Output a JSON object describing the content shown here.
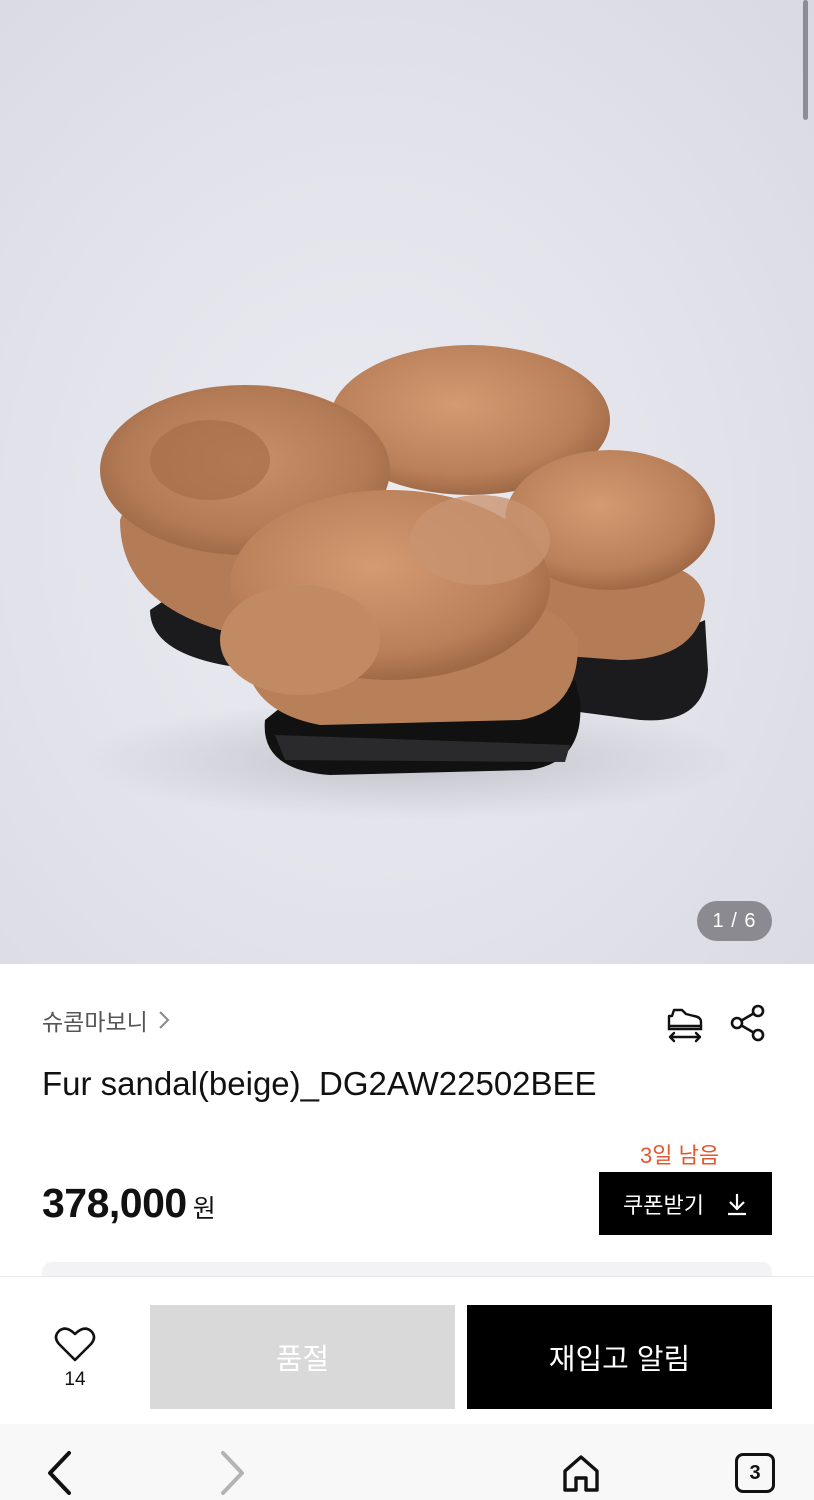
{
  "gallery": {
    "image_alt": "Fur sandal product photo",
    "current_index": 1,
    "total": 6,
    "indicator_text": "1 / 6"
  },
  "product": {
    "brand": "슈콤마보니",
    "title": "Fur sandal(beige)_DG2AW22502BEE",
    "price": "378,000",
    "currency_unit": "원"
  },
  "coupon": {
    "remaining_text": "3일 남음",
    "button_label": "쿠폰받기",
    "remaining_color": "#e4572e"
  },
  "actions": {
    "like_count": "14",
    "soldout_label": "품절",
    "restock_label": "재입고 알림"
  },
  "browser": {
    "tab_count": "3"
  },
  "icons": {
    "brand_chevron": "chevron-right-icon",
    "size": "shoe-size-icon",
    "share": "share-icon",
    "like": "heart-icon",
    "download": "download-icon",
    "back": "back-arrow-icon",
    "forward": "forward-arrow-icon",
    "home": "home-icon",
    "tabs": "tabs-icon"
  }
}
